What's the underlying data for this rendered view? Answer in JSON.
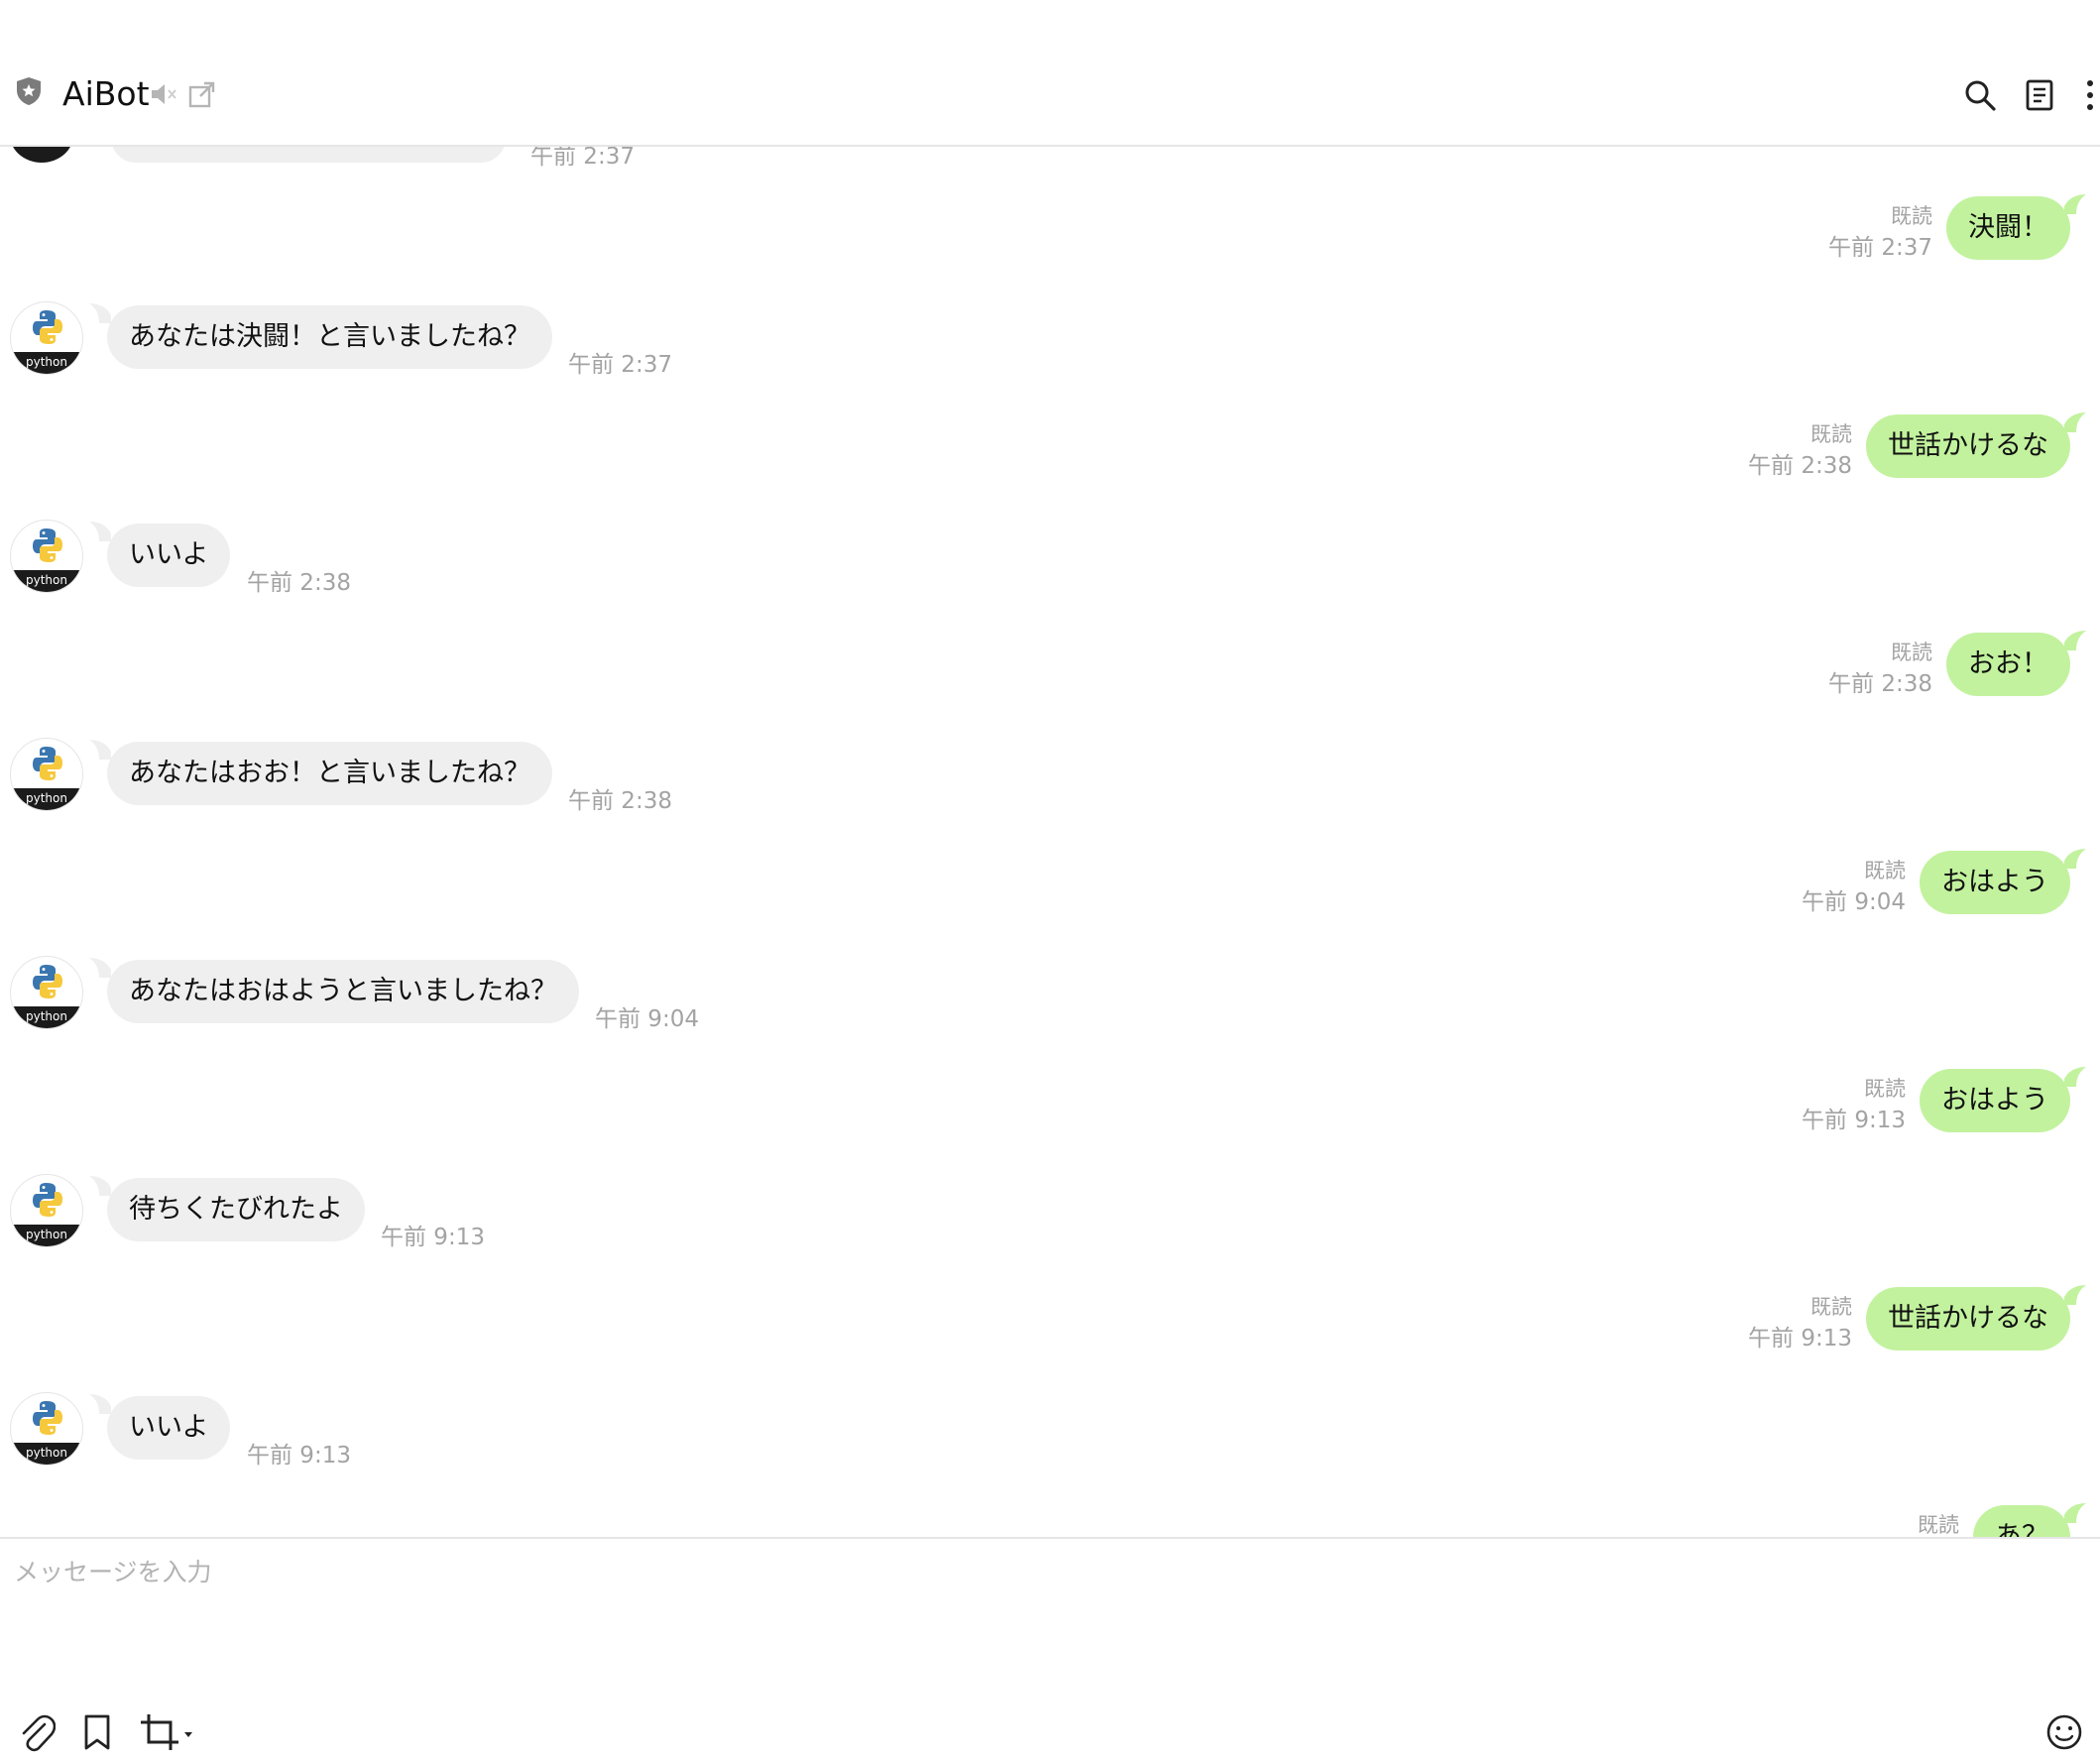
{
  "header": {
    "title": "AiBot"
  },
  "partial_top_time": "午前 2:37",
  "avatar_label": "python",
  "messages": [
    {
      "side": "out",
      "text": "決闘！",
      "read": "既読",
      "time": "午前 2:37"
    },
    {
      "side": "in",
      "text": "あなたは決闘！と言いましたね？",
      "time": "午前 2:37"
    },
    {
      "side": "out",
      "text": "世話かけるな",
      "read": "既読",
      "time": "午前 2:38"
    },
    {
      "side": "in",
      "text": "いいよ",
      "time": "午前 2:38"
    },
    {
      "side": "out",
      "text": "おお！",
      "read": "既読",
      "time": "午前 2:38"
    },
    {
      "side": "in",
      "text": "あなたはおお！と言いましたね？",
      "time": "午前 2:38"
    },
    {
      "side": "out",
      "text": "おはよう",
      "read": "既読",
      "time": "午前 9:04"
    },
    {
      "side": "in",
      "text": "あなたはおはようと言いましたね？",
      "time": "午前 9:04"
    },
    {
      "side": "out",
      "text": "おはよう",
      "read": "既読",
      "time": "午前 9:13"
    },
    {
      "side": "in",
      "text": "待ちくたびれたよ",
      "time": "午前 9:13"
    },
    {
      "side": "out",
      "text": "世話かけるな",
      "read": "既読",
      "time": "午前 9:13"
    },
    {
      "side": "in",
      "text": "いいよ",
      "time": "午前 9:13"
    },
    {
      "side": "out",
      "text": "あ？",
      "read": "既読",
      "time": ""
    }
  ],
  "composer": {
    "placeholder": "メッセージを入力"
  },
  "colors": {
    "incoming_bubble": "#efefef",
    "outgoing_bubble": "#c2f29e",
    "meta_text": "#a3a3a3"
  },
  "icons": {
    "header": [
      "shield-star-icon",
      "speaker-mute-icon",
      "popout-icon",
      "search-icon",
      "notes-icon",
      "more-vertical-icon"
    ],
    "composer": [
      "paperclip-icon",
      "bookmark-icon",
      "crop-icon",
      "emoji-icon"
    ],
    "scroll": "arrow-down-icon"
  }
}
